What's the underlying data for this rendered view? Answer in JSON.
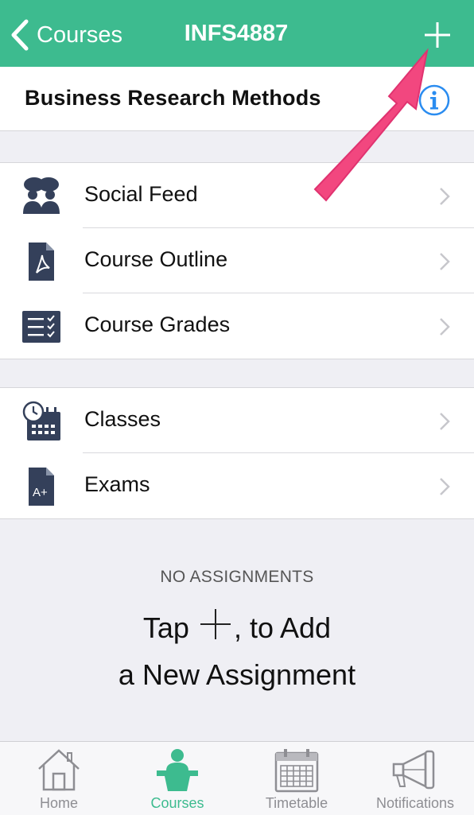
{
  "navbar": {
    "back_label": "Courses",
    "title": "INFS4887",
    "add_icon": "plus-icon",
    "background": "#3dbb8f"
  },
  "course": {
    "title": "Business Research Methods",
    "info_icon": "info-icon",
    "info_color": "#2a8cf0"
  },
  "groups": [
    {
      "items": [
        {
          "label": "Social Feed",
          "icon": "people-chat-icon"
        },
        {
          "label": "Course Outline",
          "icon": "pdf-document-icon"
        },
        {
          "label": "Course Grades",
          "icon": "checklist-icon"
        }
      ]
    },
    {
      "items": [
        {
          "label": "Classes",
          "icon": "calendar-clock-icon"
        },
        {
          "label": "Exams",
          "icon": "grade-document-icon"
        }
      ]
    }
  ],
  "assignments": {
    "empty_heading": "NO ASSIGNMENTS",
    "line1_before": "Tap",
    "line1_after": ", to Add",
    "line2": "a New Assignment"
  },
  "tabbar": {
    "tabs": [
      {
        "label": "Home",
        "icon": "house-icon",
        "active": false
      },
      {
        "label": "Courses",
        "icon": "lecturer-podium-icon",
        "active": true
      },
      {
        "label": "Timetable",
        "icon": "calendar-icon",
        "active": false
      },
      {
        "label": "Notifications",
        "icon": "megaphone-icon",
        "active": false
      }
    ],
    "accent": "#3dbb8f"
  },
  "annotation": {
    "arrow_color": "#f2477f"
  }
}
